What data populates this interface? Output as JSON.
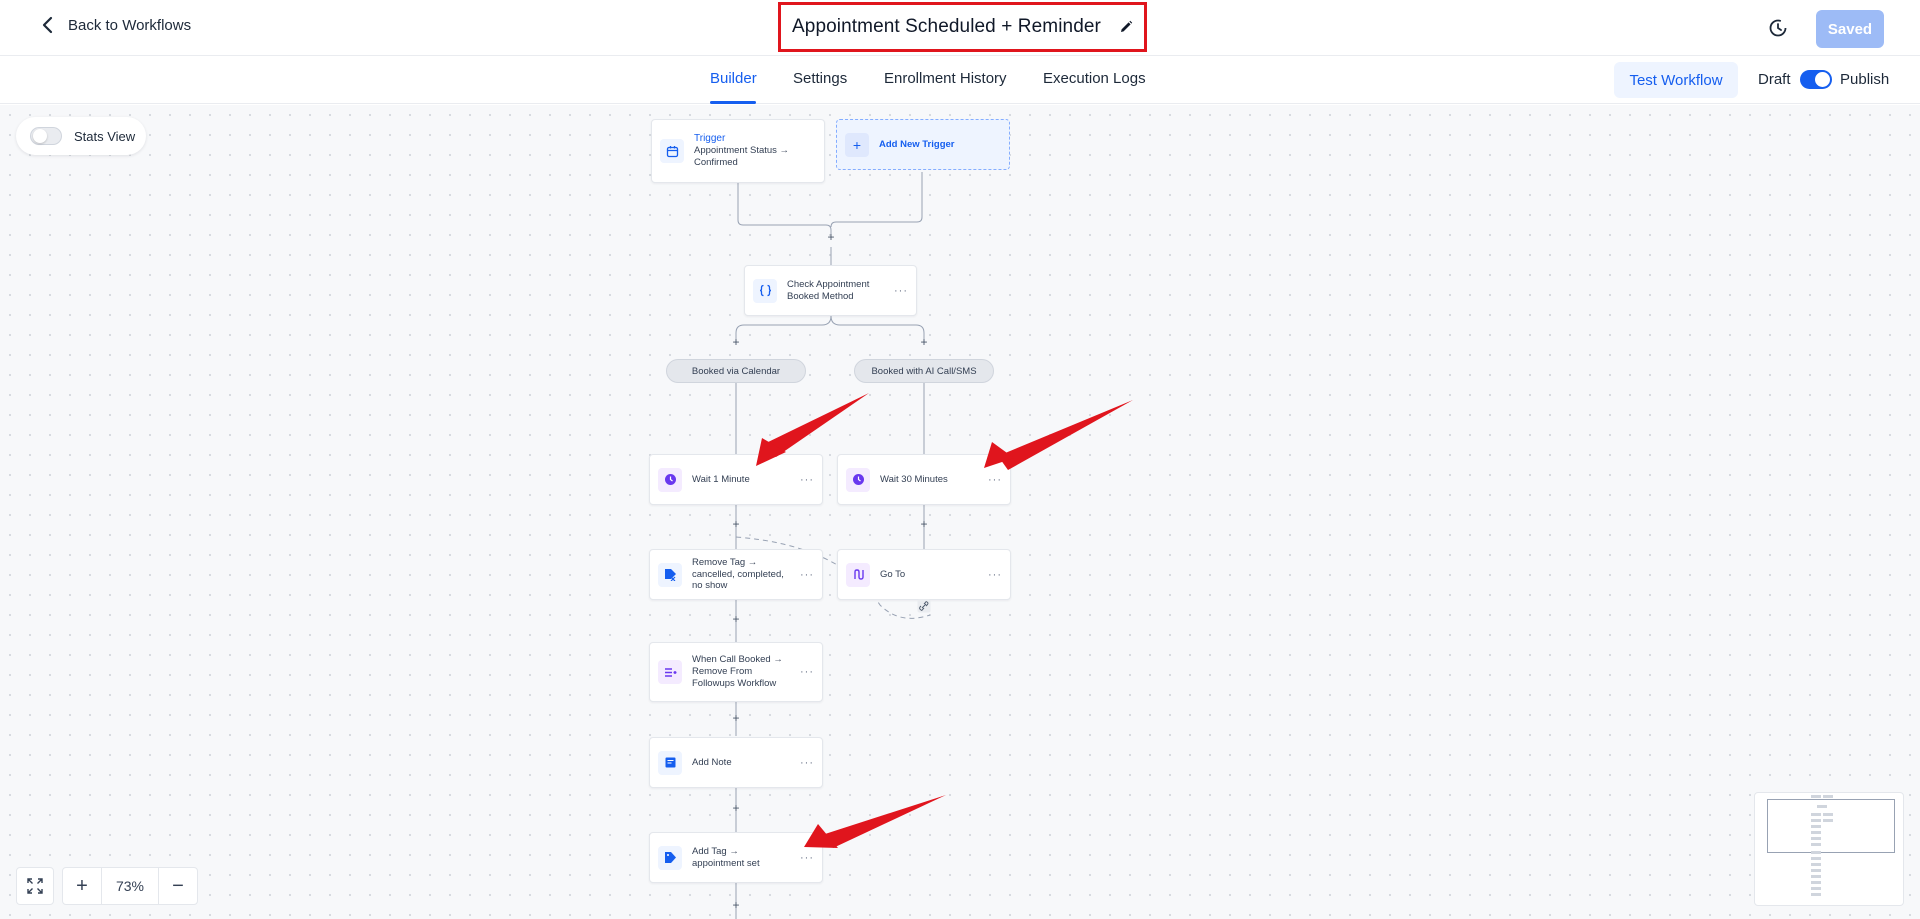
{
  "header": {
    "back_label": "Back to Workflows",
    "title": "Appointment Scheduled + Reminder",
    "saved_label": "Saved"
  },
  "tabs": [
    {
      "label": "Builder",
      "active": true
    },
    {
      "label": "Settings",
      "active": false
    },
    {
      "label": "Enrollment History",
      "active": false
    },
    {
      "label": "Execution Logs",
      "active": false
    }
  ],
  "actions": {
    "test_label": "Test Workflow",
    "draft_label": "Draft",
    "publish_label": "Publish",
    "published": true
  },
  "canvas": {
    "stats_label": "Stats View",
    "stats_on": false,
    "trigger": {
      "label": "Trigger",
      "text": "Appointment Status → Confirmed"
    },
    "add_trigger_label": "Add New Trigger",
    "condition": {
      "text": "Check Appointment Booked Method"
    },
    "branches": {
      "left": "Booked via Calendar",
      "right": "Booked with AI Call/SMS"
    },
    "left_steps": [
      {
        "text": "Wait 1 Minute",
        "icon": "clock-icon"
      },
      {
        "text": "Remove Tag → cancelled, completed, no show",
        "icon": "tag-remove-icon"
      },
      {
        "text": "When Call Booked → Remove From Followups Workflow",
        "icon": "list-remove-icon"
      },
      {
        "text": "Add Note",
        "icon": "note-icon"
      },
      {
        "text": "Add Tag → appointment set",
        "icon": "tag-icon"
      }
    ],
    "right_steps": [
      {
        "text": "Wait 30 Minutes",
        "icon": "clock-icon"
      },
      {
        "text": "Go To",
        "icon": "goto-icon"
      }
    ],
    "more_label": "···",
    "zoom": "73%"
  },
  "colors": {
    "accent": "#155eef",
    "annotation": "#e0151d",
    "saved_button": "#9dbbf6"
  }
}
